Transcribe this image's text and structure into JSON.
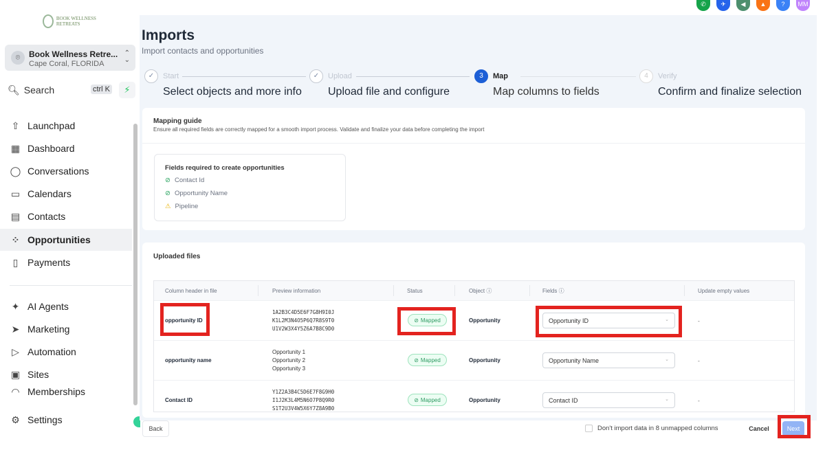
{
  "sidebar": {
    "logo_text": "BOOK WELLNESS RETREATS",
    "location": {
      "name": "Book Wellness Retre...",
      "city": "Cape Coral, FLORIDA"
    },
    "search": {
      "label": "Search",
      "shortcut": "ctrl K"
    },
    "items": [
      {
        "label": "Launchpad",
        "icon": "rocket-icon"
      },
      {
        "label": "Dashboard",
        "icon": "grid-icon"
      },
      {
        "label": "Conversations",
        "icon": "chat-icon"
      },
      {
        "label": "Calendars",
        "icon": "calendar-icon"
      },
      {
        "label": "Contacts",
        "icon": "contacts-icon"
      },
      {
        "label": "Opportunities",
        "icon": "opportunities-icon",
        "active": true
      },
      {
        "label": "Payments",
        "icon": "payments-icon"
      },
      {
        "label": "AI Agents",
        "icon": "sparkle-icon"
      },
      {
        "label": "Marketing",
        "icon": "send-icon"
      },
      {
        "label": "Automation",
        "icon": "automation-icon"
      },
      {
        "label": "Sites",
        "icon": "sites-icon"
      },
      {
        "label": "Memberships",
        "icon": "memberships-icon"
      }
    ],
    "settings": "Settings"
  },
  "topbar": {
    "icons": [
      {
        "name": "phone-icon",
        "color": "#16a34a"
      },
      {
        "name": "satellite-icon",
        "color": "#2563eb"
      },
      {
        "name": "megaphone-icon",
        "color": "#4d8f6e"
      },
      {
        "name": "bell-icon",
        "color": "#f97316"
      },
      {
        "name": "help-icon",
        "color": "#3b82f6",
        "text": "?"
      },
      {
        "name": "avatar",
        "color": "#c084fc",
        "text": "MM"
      }
    ]
  },
  "page": {
    "title": "Imports",
    "subtitle": "Import contacts and opportunities"
  },
  "steps": [
    {
      "num": "✓",
      "label": "Start",
      "desc": "Select objects and more info",
      "state": "done"
    },
    {
      "num": "✓",
      "label": "Upload",
      "desc": "Upload file and configure",
      "state": "done"
    },
    {
      "num": "3",
      "label": "Map",
      "desc": "Map columns to fields",
      "state": "active"
    },
    {
      "num": "4",
      "label": "Verify",
      "desc": "Confirm and finalize selection",
      "state": "todo"
    }
  ],
  "guide": {
    "title": "Mapping guide",
    "desc": "Ensure all required fields are correctly mapped for a smooth import process. Validate and finalize your data before completing the import",
    "req_title": "Fields required to create opportunities",
    "req": [
      {
        "label": "Contact Id",
        "state": "ok"
      },
      {
        "label": "Opportunity Name",
        "state": "ok"
      },
      {
        "label": "Pipeline",
        "state": "warn"
      }
    ]
  },
  "uploaded": {
    "title": "Uploaded files",
    "headers": [
      "Column header in file",
      "Preview information",
      "Status",
      "Object",
      "Fields",
      "Update empty values"
    ],
    "rows": [
      {
        "col": "opportunity ID",
        "preview": [
          "1A2B3C4D5E6F7G8H9I0J",
          "K1L2M3N4O5P6Q7R8S9T0",
          "U1V2W3X4Y5Z6A7B8C9D0"
        ],
        "status": "Mapped",
        "object": "Opportunity",
        "field": "Opportunity ID",
        "update": "-"
      },
      {
        "col": "opportunity name",
        "preview": [
          "Opportunity 1",
          "Opportunity 2",
          "Opportunity 3"
        ],
        "status": "Mapped",
        "object": "Opportunity",
        "field": "Opportunity Name",
        "update": "-"
      },
      {
        "col": "Contact ID",
        "preview": [
          "Y1Z2A3B4C5D6E7F8G9H0",
          "I1J2K3L4M5N6O7P8Q9R0",
          "S1T2U3V4W5X6Y7Z8A9B0"
        ],
        "status": "Mapped",
        "object": "Opportunity",
        "field": "Contact ID",
        "update": "-"
      }
    ]
  },
  "footer": {
    "back": "Back",
    "skip_label": "Don't import data in 8 unmapped columns",
    "cancel": "Cancel",
    "next": "Next"
  }
}
